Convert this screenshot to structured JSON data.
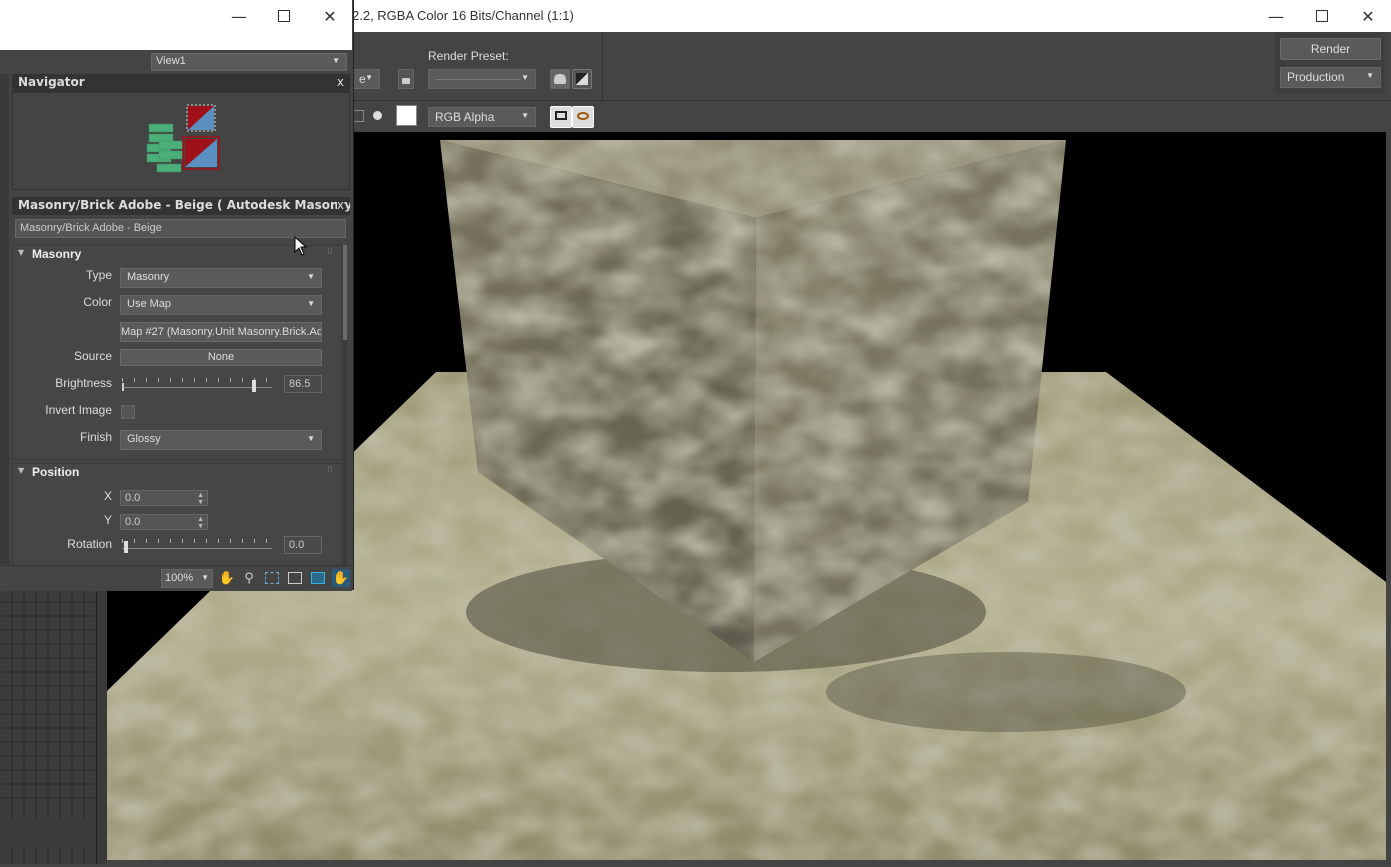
{
  "render_window": {
    "title": "2.2, RGBA Color 16 Bits/Channel (1:1)",
    "render_preset_label": "Render Preset:",
    "render_preset_value": "",
    "preset_partial": "e",
    "render_button": "Render",
    "production_value": "Production",
    "channel_value": "RGB Alpha"
  },
  "material_editor": {
    "view_dropdown": "View1",
    "navigator_title": "Navigator",
    "material_title": "Masonry/Brick Adobe - Beige  ( Autodesk Masonry...",
    "material_name": "Masonry/Brick Adobe - Beige",
    "masonry": {
      "title": "Masonry",
      "type_label": "Type",
      "type_value": "Masonry",
      "color_label": "Color",
      "color_value": "Use Map",
      "map_value": "Map #27 (Masonry.Unit Masonry.Brick.Ad",
      "source_label": "Source",
      "source_value": "None",
      "brightness_label": "Brightness",
      "brightness_value": "86.5",
      "brightness_fraction": 0.865,
      "invert_label": "Invert Image",
      "finish_label": "Finish",
      "finish_value": "Glossy"
    },
    "position": {
      "title": "Position",
      "x_label": "X",
      "x_value": "0.0",
      "y_label": "Y",
      "y_value": "0.0",
      "rotation_label": "Rotation",
      "rotation_value": "0.0"
    },
    "zoom_value": "100%"
  },
  "colors": {
    "panel_bg": "#444444",
    "swatch_green": "#4caf7a",
    "swatch_red": "#a01018",
    "swatch_blue": "#5b8fc0"
  }
}
